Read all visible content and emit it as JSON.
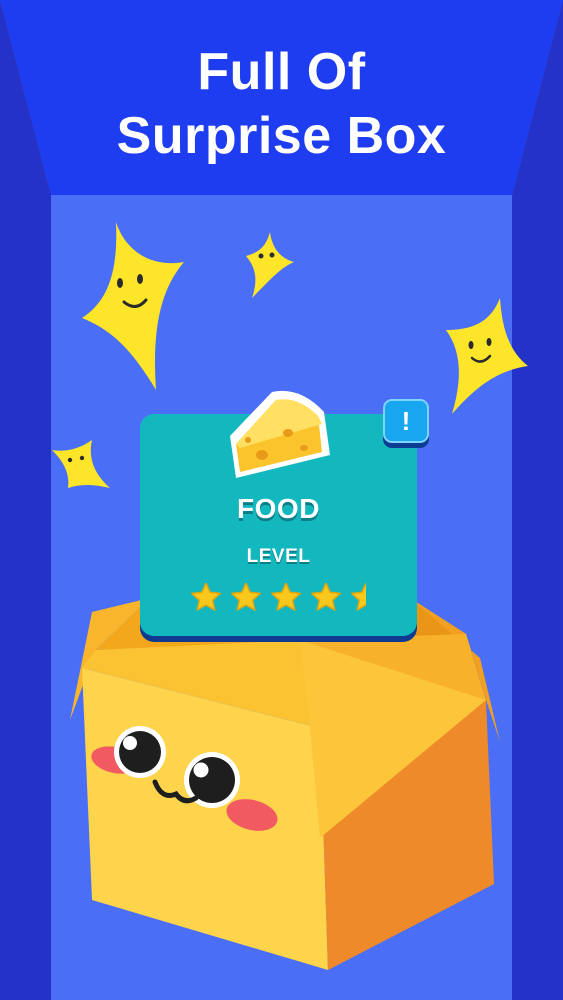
{
  "headline": {
    "line1": "Full Of",
    "line2": "Surprise Box"
  },
  "card": {
    "category": "FOOD",
    "level_label": "LEVEL",
    "level_stars": 4.5,
    "max_stars": 5,
    "item_icon": "cheese-icon",
    "info_icon": "exclamation-icon",
    "info_symbol": "!"
  },
  "colors": {
    "background": "#4a6ef5",
    "side_walls": "#2432c8",
    "top_band": "#1e3df0",
    "card": "#13b8bf",
    "star": "#f8c91c",
    "box": "#fbc232",
    "sparkle": "#fde52a",
    "info_badge": "#19a6f0"
  }
}
